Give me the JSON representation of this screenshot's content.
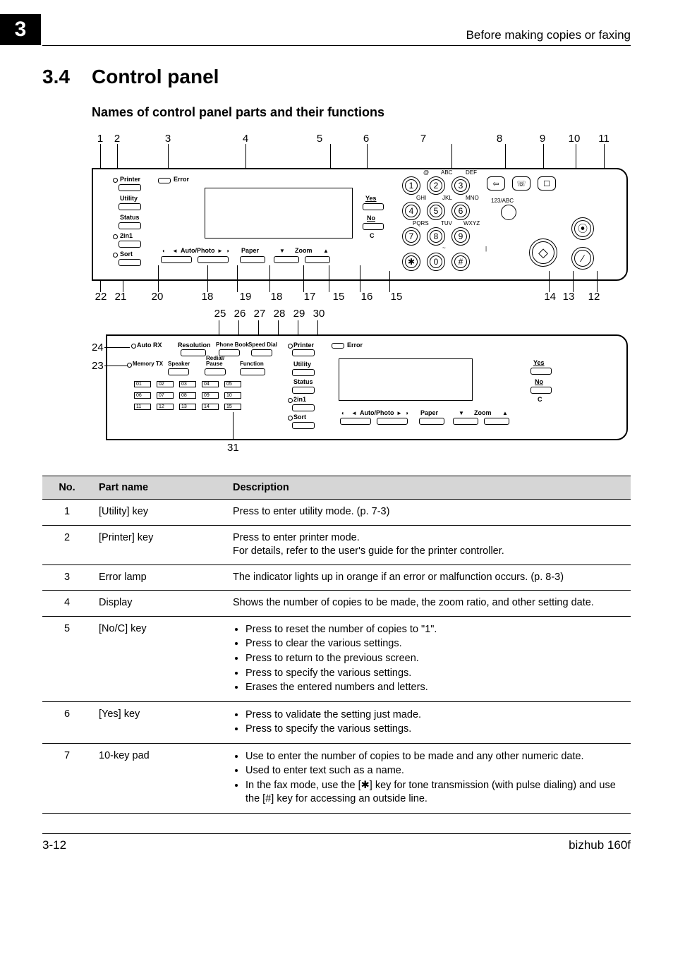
{
  "chapter_tab": "3",
  "header_right": "Before making copies or faxing",
  "section": {
    "number": "3.4",
    "title": "Control panel"
  },
  "subsection": "Names of control panel parts and their functions",
  "footer": {
    "left": "3-12",
    "right": "bizhub 160f"
  },
  "diagram": {
    "top_callouts": [
      "1",
      "2",
      "3",
      "4",
      "5",
      "6",
      "7",
      "8",
      "9",
      "10",
      "11"
    ],
    "bottom_callouts": [
      "22",
      "21",
      "20",
      "18",
      "19",
      "18",
      "17",
      "15",
      "16",
      "15",
      "14",
      "13",
      "12"
    ],
    "mid_callouts": [
      "25",
      "26",
      "27",
      "28",
      "29",
      "30"
    ],
    "left_callouts": {
      "c24": "24",
      "c23": "23",
      "c31": "31"
    },
    "left_btns": [
      "Printer",
      "Utility",
      "Status",
      "2in1",
      "Sort"
    ],
    "left_btns_b": [
      "Printer",
      "Utility",
      "Status",
      "2in1",
      "Sort"
    ],
    "center_btns_top": {
      "error": "Error",
      "auto_photo": "Auto/Photo",
      "paper": "Paper",
      "zoom": "Zoom",
      "left_arrow": "◄",
      "right_arrow": "►",
      "dark": "◐",
      "down": "▼",
      "up": "▲"
    },
    "center_btns_b": {
      "error": "Error",
      "auto_photo": "Auto/Photo",
      "paper": "Paper",
      "zoom": "Zoom",
      "left_arrow": "◄",
      "right_arrow": "►",
      "dark": "◐",
      "down": "▼",
      "up": "▲"
    },
    "right_labels": {
      "yes": "Yes",
      "no": "No",
      "c": "C",
      "abc": "ABC",
      "def": "DEF",
      "ghi": "GHI",
      "jkl": "JKL",
      "mno": "MNO",
      "pqrs": "PQRS",
      "tuv": "TUV",
      "wxyz": "WXYZ",
      "mode": "123/ABC",
      "at": "@",
      "tilde": "~"
    },
    "keypad": [
      "1",
      "2",
      "3",
      "4",
      "5",
      "6",
      "7",
      "8",
      "9",
      "✱",
      "0",
      "#"
    ],
    "aux_keys": {
      "a": "⇦",
      "b": "☏",
      "c": "☐"
    },
    "big_keys": {
      "stop": "◇",
      "reset": "⦿",
      "clear": "⁄"
    },
    "row2_labels": {
      "auto_rx": "Auto RX",
      "resolution": "Resolution",
      "phonebook": "Phone Book",
      "speed_dial": "Speed Dial",
      "memory_tx": "Memory TX",
      "speaker": "Speaker",
      "redial": "Redial/\nPause",
      "function": "Function"
    },
    "onedial": [
      "01",
      "02",
      "03",
      "04",
      "05",
      "06",
      "07",
      "08",
      "09",
      "10",
      "11",
      "12",
      "13",
      "14",
      "15"
    ],
    "right_labels_b": {
      "yes": "Yes",
      "no": "No",
      "c": "C"
    }
  },
  "table": {
    "headers": {
      "no": "No.",
      "part": "Part name",
      "desc": "Description"
    },
    "rows": [
      {
        "no": "1",
        "part": "[Utility] key",
        "desc": "Press to enter utility mode. (p. 7-3)"
      },
      {
        "no": "2",
        "part": "[Printer] key",
        "desc": "Press to enter printer mode.\nFor details, refer to the user's guide for the printer controller."
      },
      {
        "no": "3",
        "part": "Error lamp",
        "desc": "The indicator lights up in orange if an error or malfunction occurs. (p. 8-3)"
      },
      {
        "no": "4",
        "part": "Display",
        "desc": "Shows the number of copies to be made, the zoom ratio, and other setting date."
      },
      {
        "no": "5",
        "part": "[No/C] key",
        "bullets": [
          "Press to reset the number of copies to \"1\".",
          "Press to clear the various settings.",
          "Press to return to the previous screen.",
          "Press to specify the various settings.",
          "Erases the entered numbers and letters."
        ]
      },
      {
        "no": "6",
        "part": "[Yes] key",
        "bullets": [
          "Press to validate the setting just made.",
          "Press to specify the various settings."
        ]
      },
      {
        "no": "7",
        "part": "10-key pad",
        "bullets": [
          "Use to enter the number of copies to be made and any other numeric date.",
          "Used to enter text such as a name.",
          "In the fax mode, use the [✱] key for tone transmission (with pulse dialing) and use the [#] key for accessing an outside line."
        ]
      }
    ]
  }
}
